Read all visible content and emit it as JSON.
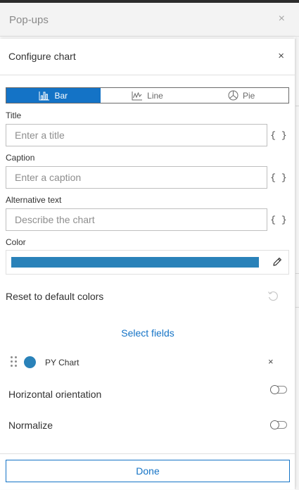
{
  "background_panel": {
    "title": "Pop-ups",
    "close_glyph": "×"
  },
  "panel": {
    "title": "Configure chart",
    "close_glyph": "×"
  },
  "chart_type": {
    "options": [
      {
        "label": "Bar",
        "icon": "bar-chart-icon",
        "selected": true
      },
      {
        "label": "Line",
        "icon": "line-chart-icon",
        "selected": false
      },
      {
        "label": "Pie",
        "icon": "pie-chart-icon",
        "selected": false
      }
    ]
  },
  "fields": {
    "title": {
      "label": "Title",
      "placeholder": "Enter a title",
      "value": ""
    },
    "caption": {
      "label": "Caption",
      "placeholder": "Enter a caption",
      "value": ""
    },
    "alt_text": {
      "label": "Alternative text",
      "placeholder": "Describe the chart",
      "value": ""
    },
    "expression_glyph": "{ }"
  },
  "color": {
    "label": "Color",
    "value": "#2a82b9",
    "edit_icon": "pencil-icon"
  },
  "reset": {
    "label": "Reset to default colors",
    "icon": "reset-icon"
  },
  "select_fields": {
    "label": "Select fields"
  },
  "field_list": [
    {
      "name": "PY Chart",
      "color": "#2a82b9",
      "remove_glyph": "×"
    }
  ],
  "options": {
    "horizontal": {
      "label": "Horizontal orientation",
      "enabled": false
    },
    "normalize": {
      "label": "Normalize",
      "enabled": false
    }
  },
  "footer": {
    "done_label": "Done"
  },
  "colors": {
    "accent": "#1473c6",
    "text": "#323232",
    "placeholder": "#8e8e8e"
  }
}
